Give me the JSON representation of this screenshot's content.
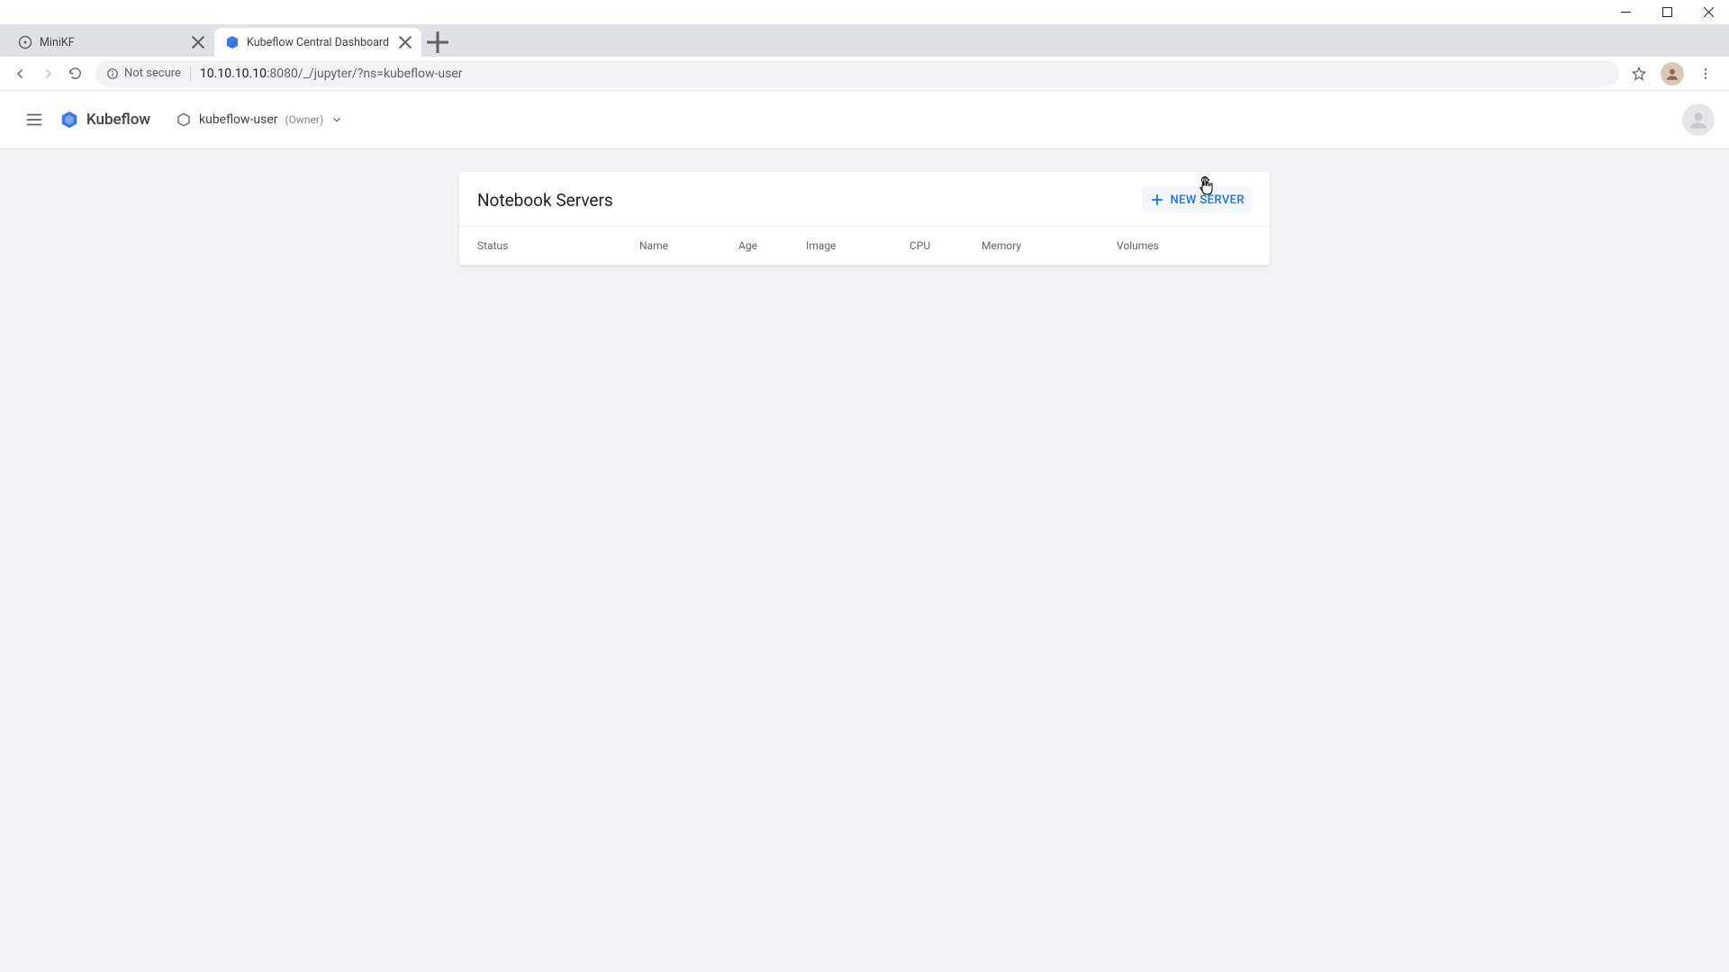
{
  "window": {
    "tabs": [
      {
        "title": "MiniKF",
        "active": false
      },
      {
        "title": "Kubeflow Central Dashboard",
        "active": true
      }
    ]
  },
  "omnibox": {
    "security_label": "Not secure",
    "url_host": "10.10.10.10",
    "url_port": ":8080",
    "url_path": "/_/jupyter/?ns=kubeflow-user"
  },
  "app_header": {
    "brand": "Kubeflow",
    "namespace": "kubeflow-user",
    "role_label": "(Owner)"
  },
  "card": {
    "title": "Notebook Servers",
    "new_server_label": "NEW SERVER",
    "columns": {
      "status": "Status",
      "name": "Name",
      "age": "Age",
      "image": "Image",
      "cpu": "CPU",
      "memory": "Memory",
      "volumes": "Volumes"
    },
    "rows": []
  },
  "colors": {
    "accent": "#1a73e8",
    "surface": "#ffffff",
    "page_bg": "#f1f3f4"
  }
}
